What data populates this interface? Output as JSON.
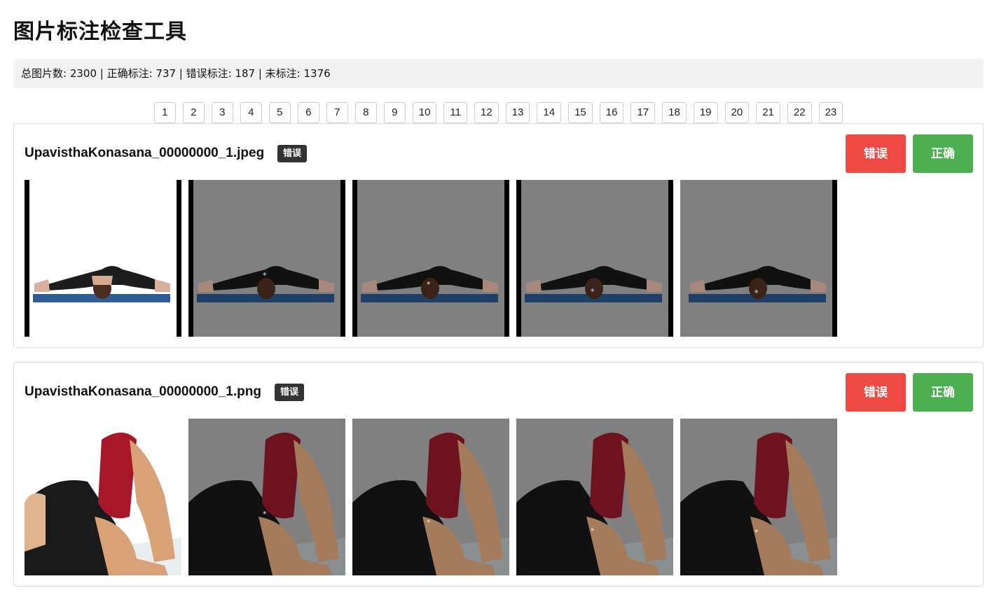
{
  "app": {
    "title": "图片标注检查工具"
  },
  "stats": {
    "text": "总图片数: 2300 | 正确标注: 737 | 错误标注: 187 | 未标注: 1376"
  },
  "pagination": [
    "1",
    "2",
    "3",
    "4",
    "5",
    "6",
    "7",
    "8",
    "9",
    "10",
    "11",
    "12",
    "13",
    "14",
    "15",
    "16",
    "17",
    "18",
    "19",
    "20",
    "21",
    "22",
    "23"
  ],
  "cards": [
    {
      "filename": "UpavisthaKonasana_00000000_1.jpeg",
      "status": "错误",
      "wrong_label": "错误",
      "right_label": "正确"
    },
    {
      "filename": "UpavisthaKonasana_00000000_1.png",
      "status": "错误",
      "wrong_label": "错误",
      "right_label": "正确"
    }
  ],
  "keypoint_marker": "*",
  "colors": {
    "wrong": "#ef4944",
    "right": "#4caf50",
    "badge": "#333333",
    "stats_bg": "#f2f2f2",
    "overlay_gray": "#808080"
  }
}
